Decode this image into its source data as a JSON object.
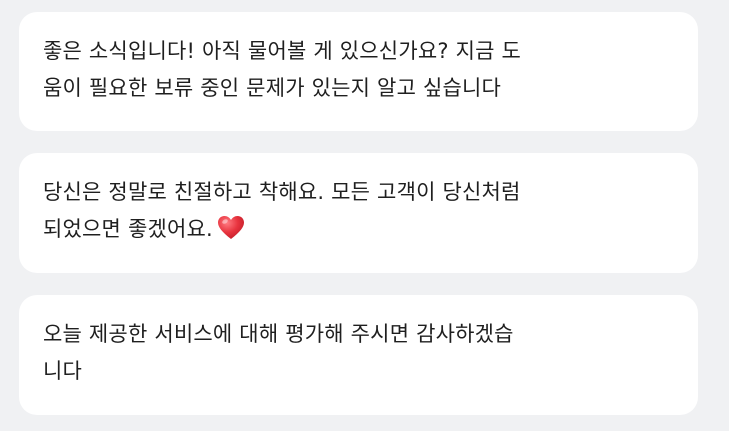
{
  "messages": [
    {
      "lines": [
        "좋은 소식입니다! 아직 물어볼 게 있으신가요? 지금 도",
        "움이 필요한 보류 중인 문제가 있는지 알고 싶습니다"
      ]
    },
    {
      "lines": [
        "당신은 정말로 친절하고 착해요. 모든 고객이 당신처럼",
        "되었으면 좋겠어요."
      ],
      "trailing_icon": "heart-icon",
      "icon_color": "#e8343f"
    },
    {
      "lines": [
        "오늘 제공한 서비스에 대해 평가해 주시면 감사하겠습",
        "니다"
      ]
    }
  ],
  "colors": {
    "background": "#f0f1f3",
    "bubble": "#ffffff",
    "text": "#1f1f1f"
  }
}
